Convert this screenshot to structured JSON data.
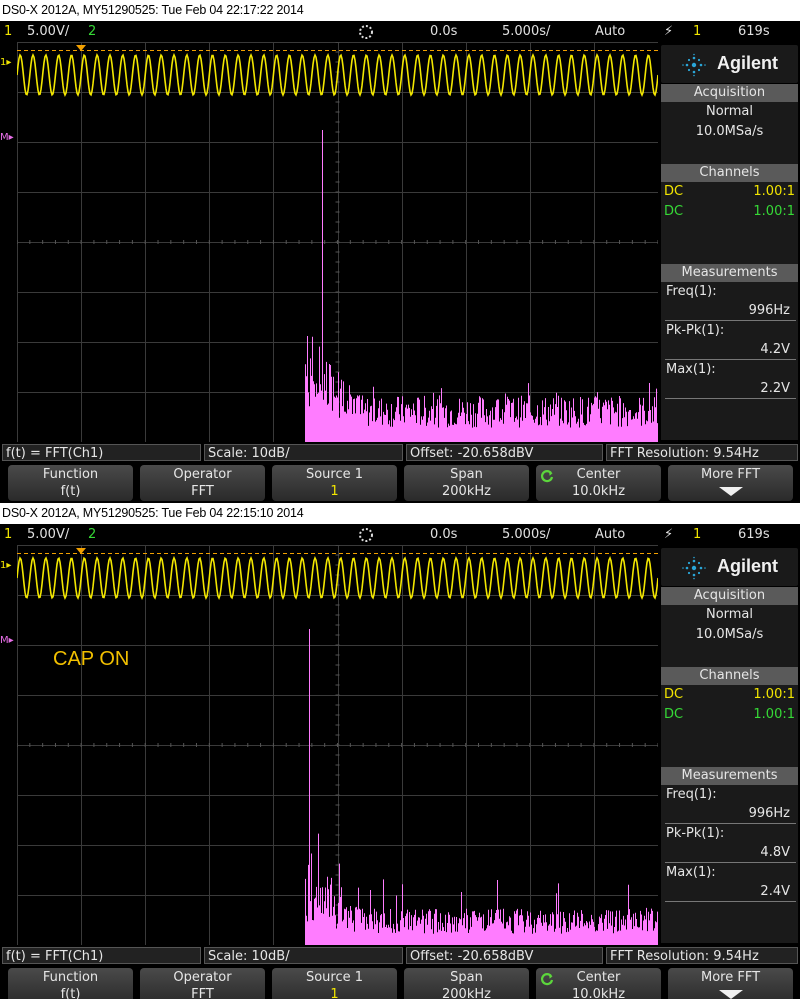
{
  "colors": {
    "ch1": "#f2e600",
    "ch2": "#36d936",
    "math": "#ff7cff",
    "grid": "#3a3a3a",
    "panel_head": "#5a5a5a"
  },
  "screens": [
    {
      "title": "DS0-X 2012A, MY51290525: Tue Feb 04 22:17:22 2014",
      "status": {
        "ch1_num": "1",
        "ch1_scale": "5.00V/",
        "ch2_num": "2",
        "run_icon": "run-stop-icon",
        "time_pos": "0.0s",
        "time_scale": "5.000s/",
        "trigger_mode": "Auto",
        "trigger_icon": "trigger-edge-icon",
        "trigger_source": "1",
        "trigger_level": "619s"
      },
      "annotation": "",
      "brand": "Agilent",
      "acquisition": {
        "header": "Acquisition",
        "mode": "Normal",
        "rate": "10.0MSa/s"
      },
      "channels": {
        "header": "Channels",
        "rows": [
          {
            "coupling": "DC",
            "probe": "1.00:1"
          },
          {
            "coupling": "DC",
            "probe": "1.00:1"
          }
        ]
      },
      "measurements": {
        "header": "Measurements",
        "items": [
          {
            "label": "Freq(1):",
            "value": "996Hz"
          },
          {
            "label": "Pk-Pk(1):",
            "value": "4.2V"
          },
          {
            "label": "Max(1):",
            "value": "2.2V"
          }
        ]
      },
      "fft_bar": {
        "function": "f(t) = FFT(Ch1)",
        "scale": "Scale: 10dB/",
        "offset": "Offset: -20.658dBV",
        "resolution": "FFT Resolution: 9.54Hz"
      },
      "softkeys": [
        {
          "label": "Function",
          "value": "f(t)"
        },
        {
          "label": "Operator",
          "value": "FFT"
        },
        {
          "label": "Source 1",
          "value": "1"
        },
        {
          "label": "Span",
          "value": "200kHz"
        },
        {
          "label": "Center",
          "value": "10.0kHz",
          "icon": "entry-knob-icon"
        },
        {
          "label": "More FFT",
          "value": "",
          "icon": "down-arrow-icon"
        }
      ],
      "spectrum": {
        "start_frac": 0.45,
        "peak_frac": 0.476,
        "peak_level": 0.78,
        "cluster_level": 0.3,
        "noise_level": 0.09,
        "seed": 7
      }
    },
    {
      "title": "DS0-X 2012A, MY51290525: Tue Feb 04 22:15:10 2014",
      "status": {
        "ch1_num": "1",
        "ch1_scale": "5.00V/",
        "ch2_num": "2",
        "run_icon": "run-stop-icon",
        "time_pos": "0.0s",
        "time_scale": "5.000s/",
        "trigger_mode": "Auto",
        "trigger_icon": "trigger-edge-icon",
        "trigger_source": "1",
        "trigger_level": "619s"
      },
      "annotation": "CAP ON",
      "brand": "Agilent",
      "acquisition": {
        "header": "Acquisition",
        "mode": "Normal",
        "rate": "10.0MSa/s"
      },
      "channels": {
        "header": "Channels",
        "rows": [
          {
            "coupling": "DC",
            "probe": "1.00:1"
          },
          {
            "coupling": "DC",
            "probe": "1.00:1"
          }
        ]
      },
      "measurements": {
        "header": "Measurements",
        "items": [
          {
            "label": "Freq(1):",
            "value": "996Hz"
          },
          {
            "label": "Pk-Pk(1):",
            "value": "4.8V"
          },
          {
            "label": "Max(1):",
            "value": "2.4V"
          }
        ]
      },
      "fft_bar": {
        "function": "f(t) = FFT(Ch1)",
        "scale": "Scale: 10dB/",
        "offset": "Offset: -20.658dBV",
        "resolution": "FFT Resolution: 9.54Hz"
      },
      "softkeys": [
        {
          "label": "Function",
          "value": "f(t)"
        },
        {
          "label": "Operator",
          "value": "FFT"
        },
        {
          "label": "Source 1",
          "value": "1"
        },
        {
          "label": "Span",
          "value": "200kHz"
        },
        {
          "label": "Center",
          "value": "10.0kHz",
          "icon": "entry-knob-icon"
        },
        {
          "label": "More FFT",
          "value": "",
          "icon": "down-arrow-icon"
        }
      ],
      "spectrum": {
        "start_frac": 0.45,
        "peak_frac": 0.455,
        "peak_level": 0.79,
        "cluster_level": 0.25,
        "noise_level": 0.07,
        "seed": 13
      }
    }
  ]
}
